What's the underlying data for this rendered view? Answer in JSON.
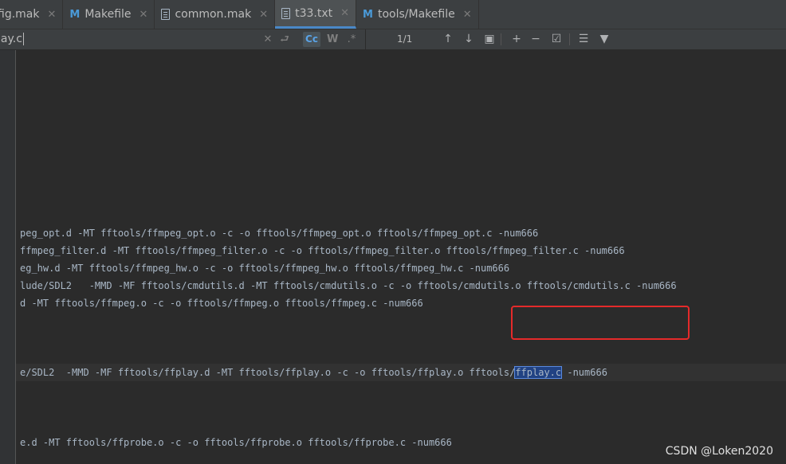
{
  "tabs": [
    {
      "label": "fig.mak",
      "icon": "none",
      "active": false
    },
    {
      "label": "Makefile",
      "icon": "M",
      "active": false
    },
    {
      "label": "common.mak",
      "icon": "file",
      "active": false
    },
    {
      "label": "t33.txt",
      "icon": "file",
      "active": true
    },
    {
      "label": "tools/Makefile",
      "icon": "M",
      "active": false
    }
  ],
  "search": {
    "query": "lay.c",
    "case_toggle": "Cc",
    "word_toggle": "W",
    "regex_toggle": ".*",
    "match_count": "1/1"
  },
  "editor": {
    "lines": [
      "peg_opt.d -MT fftools/ffmpeg_opt.o -c -o fftools/ffmpeg_opt.o fftools/ffmpeg_opt.c -num666",
      "ffmpeg_filter.d -MT fftools/ffmpeg_filter.o -c -o fftools/ffmpeg_filter.o fftools/ffmpeg_filter.c -num666",
      "eg_hw.d -MT fftools/ffmpeg_hw.o -c -o fftools/ffmpeg_hw.o fftools/ffmpeg_hw.c -num666",
      "lude/SDL2   -MMD -MF fftools/cmdutils.d -MT fftools/cmdutils.o -c -o fftools/cmdutils.o fftools/cmdutils.c -num666",
      "d -MT fftools/ffmpeg.o -c -o fftools/ffmpeg.o fftools/ffmpeg.c -num666"
    ],
    "current_line_prefix": "e/SDL2  -MMD -MF fftools/ffplay.d -MT fftools/ffplay.o -c -o fftools/ffplay.o fftools/",
    "current_line_match": "ffplay.c",
    "current_line_suffix": " -num666",
    "last_line": "e.d -MT fftools/ffprobe.o -c -o fftools/ffprobe.o fftools/ffprobe.c -num666"
  },
  "watermark": "CSDN @Loken2020",
  "colors": {
    "highlight_box": "#e52a2a",
    "match_bg": "#214283",
    "accent": "#4a88c7"
  }
}
